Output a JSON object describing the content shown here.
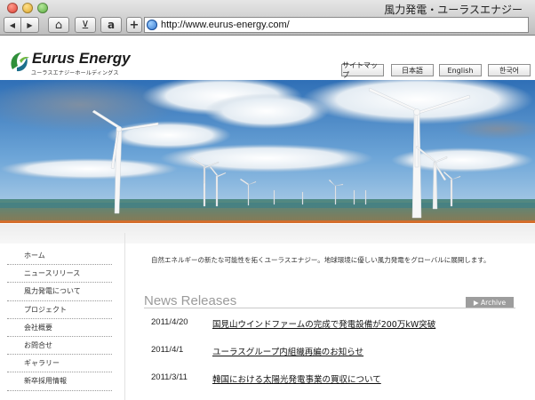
{
  "window": {
    "title": "風力発電・ユーラスエナジー"
  },
  "toolbar": {
    "back_label": "◀",
    "forward_label": "▶",
    "home_label": "⌂",
    "bookmark_label": "⊻",
    "amazon_label": "a",
    "add_label": "+",
    "address_value": "http://www.eurus-energy.com/"
  },
  "header": {
    "logo_name": "Eurus Energy",
    "logo_subtitle": "ユーラスエナジーホールディングス",
    "links": [
      "サイトマップ",
      "日本語",
      "English",
      "한국어"
    ]
  },
  "sidebar": {
    "items": [
      "ホーム",
      "ニュースリリース",
      "風力発電について",
      "プロジェクト",
      "会社概要",
      "お問合せ",
      "ギャラリー",
      "新卒採用情報"
    ]
  },
  "main": {
    "intro": "自然エネルギーの新たな可能性を拓くユーラスエナジー。地球環境に優しい風力発電をグローバルに展開します。",
    "news_heading": "News Releases",
    "archive_label": "▶ Archive",
    "news": [
      {
        "date": "2011/4/20",
        "title": "国見山ウインドファームの完成で発電設備が200万kW突破"
      },
      {
        "date": "2011/4/1",
        "title": "ユーラスグループ内組織再編のお知らせ"
      },
      {
        "date": "2011/3/11",
        "title": "韓国における太陽光発電事業の買収について"
      }
    ]
  },
  "colors": {
    "accent_orange": "#d46e2c",
    "logo_green": "#2f8f3a",
    "archive_gray": "#9d9d9d"
  }
}
